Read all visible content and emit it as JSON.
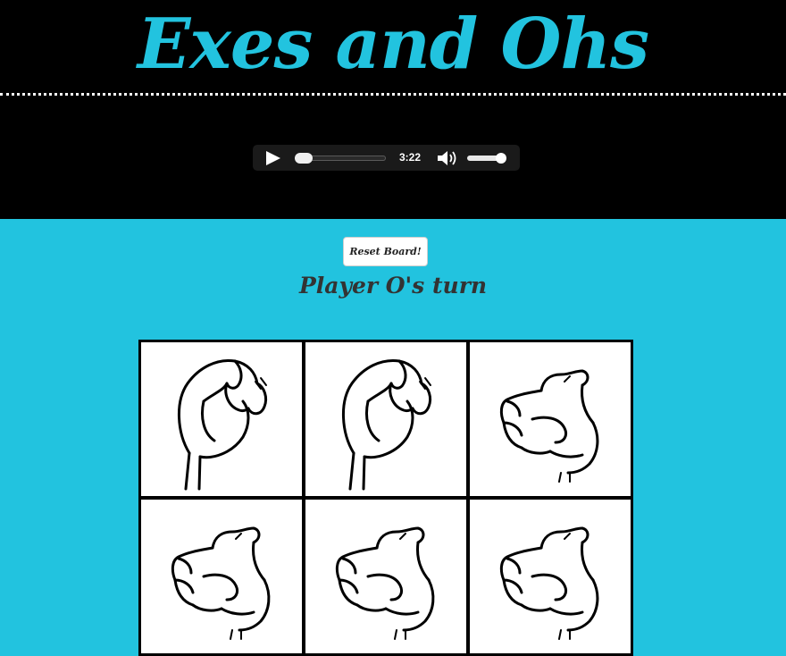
{
  "header": {
    "title": "Exes and Ohs"
  },
  "audio_player": {
    "time": "3:22",
    "progress": 0.0,
    "volume": 0.9
  },
  "controls": {
    "reset_label": "Reset Board!",
    "turn_text": "Player O's turn"
  },
  "board": {
    "cells": [
      {
        "sign": "O",
        "icon": "asl-o-hand-icon"
      },
      {
        "sign": "O",
        "icon": "asl-o-hand-icon"
      },
      {
        "sign": "X",
        "icon": "asl-x-hand-icon"
      },
      {
        "sign": "X",
        "icon": "asl-x-hand-icon"
      },
      {
        "sign": "X",
        "icon": "asl-x-hand-icon"
      },
      {
        "sign": "X",
        "icon": "asl-x-hand-icon"
      }
    ]
  },
  "colors": {
    "accent": "#22c3df",
    "header_bg": "#000000",
    "text": "#333333"
  }
}
